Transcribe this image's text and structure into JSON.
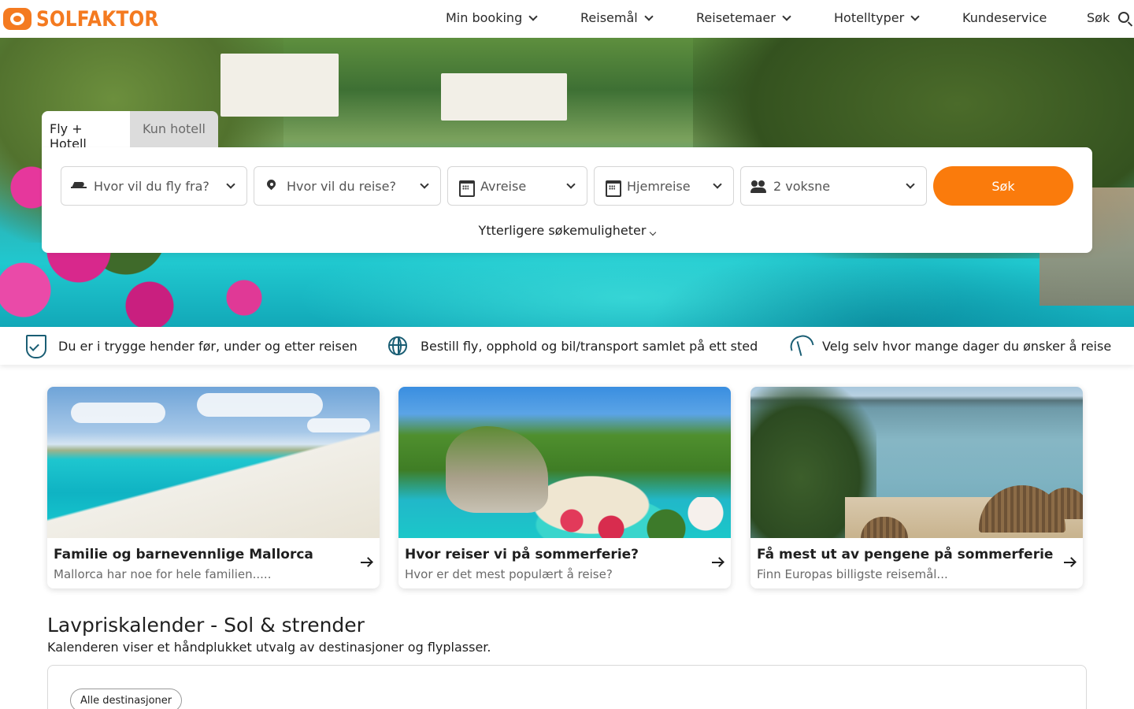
{
  "brand": {
    "name": "SOLFAKTOR",
    "color": "#f47a20"
  },
  "nav": {
    "items": [
      {
        "label": "Min booking",
        "has_dropdown": true
      },
      {
        "label": "Reisemål",
        "has_dropdown": true
      },
      {
        "label": "Reisetemaer",
        "has_dropdown": true
      },
      {
        "label": "Hotelltyper",
        "has_dropdown": true
      },
      {
        "label": "Kundeservice",
        "has_dropdown": false
      },
      {
        "label": "Søk",
        "icon": "search-icon"
      }
    ]
  },
  "search": {
    "tabs": [
      {
        "label": "Fly + Hotell",
        "active": true
      },
      {
        "label": "Kun hotell",
        "active": false
      }
    ],
    "fields": {
      "from": {
        "placeholder": "Hvor vil du fly fra?",
        "icon": "plane-icon"
      },
      "to": {
        "placeholder": "Hvor vil du reise?",
        "icon": "location-pin-icon"
      },
      "departure": {
        "placeholder": "Avreise",
        "icon": "calendar-icon"
      },
      "return": {
        "placeholder": "Hjemreise",
        "icon": "calendar-icon"
      },
      "travellers": {
        "value": "2 voksne",
        "icon": "people-icon"
      }
    },
    "submit_label": "Søk",
    "submit_color": "#fa7b0c",
    "more_options": "Ytterligere søkemuligheter"
  },
  "usp": [
    {
      "text": "Du er i trygge hender før, under og etter reisen",
      "icon": "shield-check-icon"
    },
    {
      "text": "Bestill fly, opphold og bil/transport samlet på ett sted",
      "icon": "globe-icon"
    },
    {
      "text": "Velg selv hvor mange dager du ønsker å reise",
      "icon": "beach-umbrella-icon"
    }
  ],
  "cards": [
    {
      "title": "Familie og barnevennlige Mallorca",
      "subtitle": "Mallorca har noe for hele familien....."
    },
    {
      "title": "Hvor reiser vi på sommerferie?",
      "subtitle": "Hvor er det mest populært å reise?"
    },
    {
      "title": "Få mest ut av pengene på sommerferie",
      "subtitle": "Finn Europas billigste reisemål..."
    }
  ],
  "calendar": {
    "title": "Lavpriskalender - Sol & strender",
    "subtitle": "Kalenderen viser et håndplukket utvalg av destinasjoner og flyplasser.",
    "filter_chip": "Alle destinasjoner"
  }
}
